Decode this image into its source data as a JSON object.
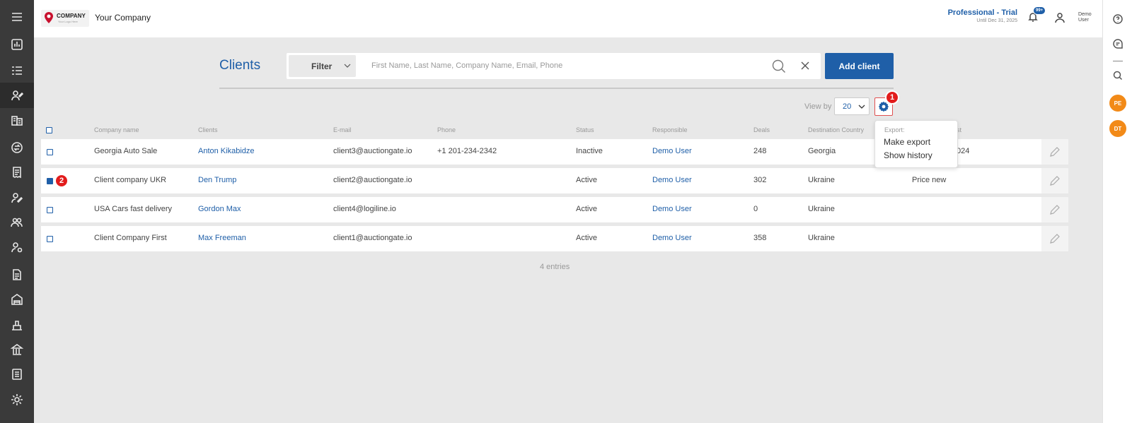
{
  "header": {
    "logo_text": "COMPANY",
    "logo_subtext": "Your Logo Here",
    "company_name": "Your Company",
    "plan_title": "Professional - Trial",
    "plan_until": "Until Dec 31, 2025",
    "notifications_badge": "99+",
    "user_name": "Demo User"
  },
  "sidebar": {
    "items": [
      {
        "icon": "menu-icon"
      },
      {
        "icon": "dashboard-icon"
      },
      {
        "icon": "list-icon"
      },
      {
        "icon": "clients-icon",
        "active": true
      },
      {
        "icon": "buildings-icon"
      },
      {
        "icon": "exchange-icon"
      },
      {
        "icon": "receipt-icon"
      },
      {
        "icon": "user-edit-icon"
      },
      {
        "icon": "users-icon"
      },
      {
        "icon": "user-settings-icon"
      },
      {
        "icon": "document-icon"
      },
      {
        "icon": "warehouse-icon"
      },
      {
        "icon": "port-icon"
      },
      {
        "icon": "bank-icon"
      },
      {
        "icon": "invoice-icon"
      },
      {
        "icon": "settings-icon"
      }
    ]
  },
  "rightbar": {
    "avatars": [
      "PE",
      "DT"
    ],
    "icons": [
      "help-icon",
      "chat-icon",
      "search-icon"
    ]
  },
  "toolbar": {
    "title": "Clients",
    "filter_label": "Filter",
    "search_placeholder": "First Name, Last Name, Company Name, Email, Phone",
    "add_label": "Add client",
    "view_by_label": "View by",
    "view_by_value": "20"
  },
  "markers": {
    "gear": "1",
    "row": "2"
  },
  "export_menu": {
    "heading": "Export:",
    "items": [
      "Make export",
      "Show history"
    ]
  },
  "table": {
    "columns": [
      "Company name",
      "Clients",
      "E-mail",
      "Phone",
      "Status",
      "Responsible",
      "Deals",
      "Destination Country",
      "st"
    ],
    "rows": [
      {
        "company": "Georgia Auto Sale",
        "client": "Anton Kikabidze",
        "email": "client3@auctiongate.io",
        "phone": "+1 201-234-2342",
        "status": "Inactive",
        "responsible": "Demo User",
        "deals": "248",
        "country": "Georgia",
        "extra": "024",
        "checked": false
      },
      {
        "company": "Client company UKR",
        "client": "Den Trump",
        "email": "client2@auctiongate.io",
        "phone": "",
        "status": "Active",
        "responsible": "Demo User",
        "deals": "302",
        "country": "Ukraine",
        "extra": "Price new",
        "checked": true
      },
      {
        "company": "USA Cars fast delivery",
        "client": "Gordon Max",
        "email": "client4@logiline.io",
        "phone": "",
        "status": "Active",
        "responsible": "Demo User",
        "deals": "0",
        "country": "Ukraine",
        "extra": "",
        "checked": false
      },
      {
        "company": "Client Company First",
        "client": "Max Freeman",
        "email": "client1@auctiongate.io",
        "phone": "",
        "status": "Active",
        "responsible": "Demo User",
        "deals": "358",
        "country": "Ukraine",
        "extra": "",
        "checked": false
      }
    ],
    "entries": "4 entries"
  },
  "colors": {
    "accent": "#1f5fa8",
    "marker": "#e21c1c",
    "avatar": "#f28a18",
    "sidebar": "#3a3a3a"
  }
}
